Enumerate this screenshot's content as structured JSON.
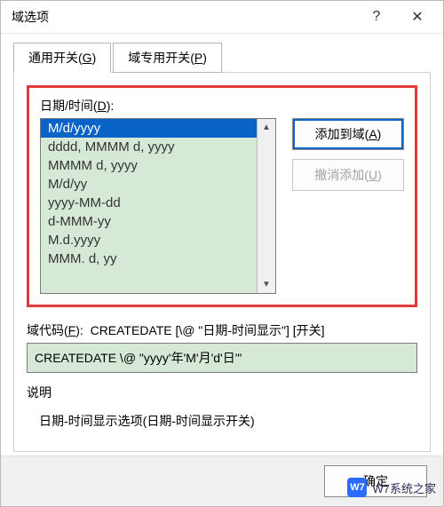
{
  "titlebar": {
    "title": "域选项",
    "help": "?",
    "close": "✕"
  },
  "tabs": {
    "general": {
      "label": "通用开关(",
      "hotkey": "G",
      "suffix": ")"
    },
    "specific": {
      "label": "域专用开关(",
      "hotkey": "P",
      "suffix": ")"
    }
  },
  "datetime": {
    "label": "日期/时间(",
    "hotkey": "D",
    "suffix": "):",
    "items": [
      "M/d/yyyy",
      "dddd, MMMM d, yyyy",
      "MMMM d, yyyy",
      "M/d/yy",
      "yyyy-MM-dd",
      "d-MMM-yy",
      "M.d.yyyy",
      "MMM. d, yy"
    ],
    "selected_index": 0
  },
  "buttons": {
    "add": {
      "label": "添加到域(",
      "hotkey": "A",
      "suffix": ")"
    },
    "undo": {
      "label": "撤消添加(",
      "hotkey": "U",
      "suffix": ")"
    }
  },
  "fieldcode": {
    "label": "域代码(",
    "hotkey": "F",
    "suffix": "):",
    "template": "CREATEDATE [\\@ \"日期-时间显示\"] [开关]",
    "value": "CREATEDATE \\@ \"yyyy'年'M'月'd'日'\""
  },
  "description": {
    "label": "说明",
    "text": "日期-时间显示选项(日期-时间显示开关)"
  },
  "footer": {
    "ok": "确定"
  },
  "watermark": "W7系统之家"
}
